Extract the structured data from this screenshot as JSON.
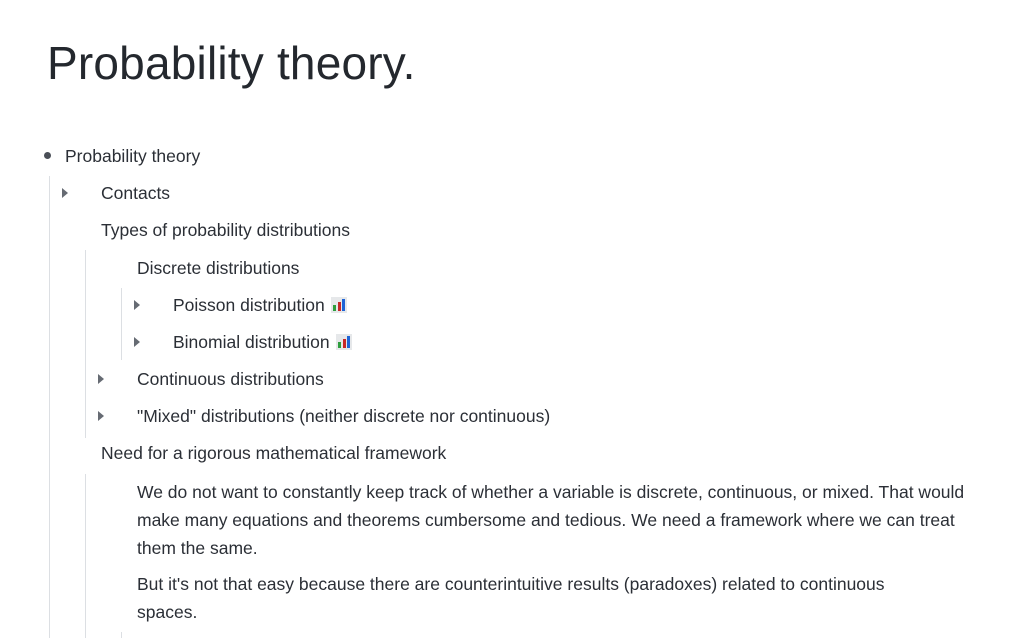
{
  "page": {
    "title": "Probability theory."
  },
  "outline": {
    "root": "Probability theory",
    "contacts": "Contacts",
    "types": "Types of probability distributions",
    "discrete": "Discrete distributions",
    "poisson": "Poisson distribution",
    "binomial": "Binomial distribution",
    "continuous": "Continuous distributions",
    "mixed": "\"Mixed\" distributions (neither discrete nor continuous)",
    "need": "Need for a rigorous mathematical framework",
    "para1": "We do not want to constantly keep track of whether a variable is discrete, continuous, or mixed. That would make many equations and theorems cumbersome and tedious. We need a framework where we can treat them the same.",
    "para2": "But it's not that easy because there are counterintuitive results (paradoxes) related to continuous spaces."
  },
  "icons": {
    "chart": "bar-chart-emoji-icon",
    "collapse": "triangle-right-icon"
  },
  "colors": {
    "text": "#2b2f36",
    "guide": "#dcdfe3",
    "bar_green": "#2e9e3e",
    "bar_red": "#c62828",
    "bar_blue": "#1e63d6"
  }
}
